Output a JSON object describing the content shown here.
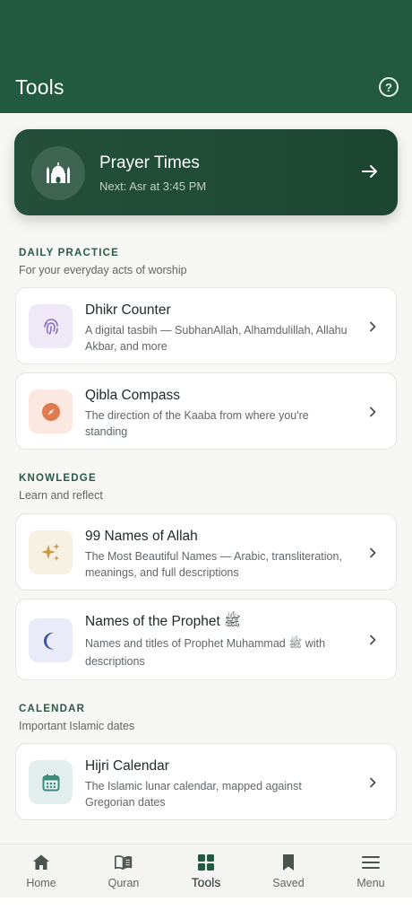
{
  "header": {
    "title": "Tools",
    "help_icon": "help-circle-icon"
  },
  "prayer_card": {
    "title": "Prayer Times",
    "subtitle": "Next: Asr at 3:45 PM",
    "icon": "mosque-icon",
    "arrow_icon": "arrow-right-icon"
  },
  "sections": {
    "daily": {
      "label": "DAILY PRACTICE",
      "subtitle": "For your everyday acts of worship"
    },
    "knowledge": {
      "label": "KNOWLEDGE",
      "subtitle": "Learn and reflect"
    },
    "calendar": {
      "label": "CALENDAR",
      "subtitle": "Important Islamic dates"
    }
  },
  "tools": {
    "dhikr": {
      "title": "Dhikr Counter",
      "desc": "A digital tasbih — SubhanAllah, Alhamdulillah, Allahu Akbar, and more",
      "icon": "fingerprint-icon",
      "icon_bg": "#efe9f7",
      "icon_color": "#8a6fc0"
    },
    "qibla": {
      "title": "Qibla Compass",
      "desc": "The direction of the Kaaba from where you're standing",
      "icon": "compass-icon",
      "icon_bg": "#fbe9e1",
      "icon_color": "#e07a4f"
    },
    "names_allah": {
      "title": "99 Names of Allah",
      "desc": "The Most Beautiful Names — Arabic, transliteration, meanings, and full descriptions",
      "icon": "sparkles-icon",
      "icon_bg": "#f7f1e4",
      "icon_color": "#c99a3d"
    },
    "names_prophet": {
      "title": "Names of the Prophet ﷺ",
      "desc": "Names and titles of Prophet Muhammad ﷺ with descriptions",
      "icon": "crescent-moon-icon",
      "icon_bg": "#e9ecf8",
      "icon_color": "#3c4fa8"
    },
    "hijri": {
      "title": "Hijri Calendar",
      "desc": "The Islamic lunar calendar, mapped against Gregorian dates",
      "icon": "calendar-icon",
      "icon_bg": "#e3efec",
      "icon_color": "#3f8a7c"
    }
  },
  "nav": {
    "home": "Home",
    "quran": "Quran",
    "tools": "Tools",
    "saved": "Saved",
    "menu": "Menu"
  },
  "colors": {
    "brand": "#215a3f",
    "card_dark": "#1f4a35"
  }
}
